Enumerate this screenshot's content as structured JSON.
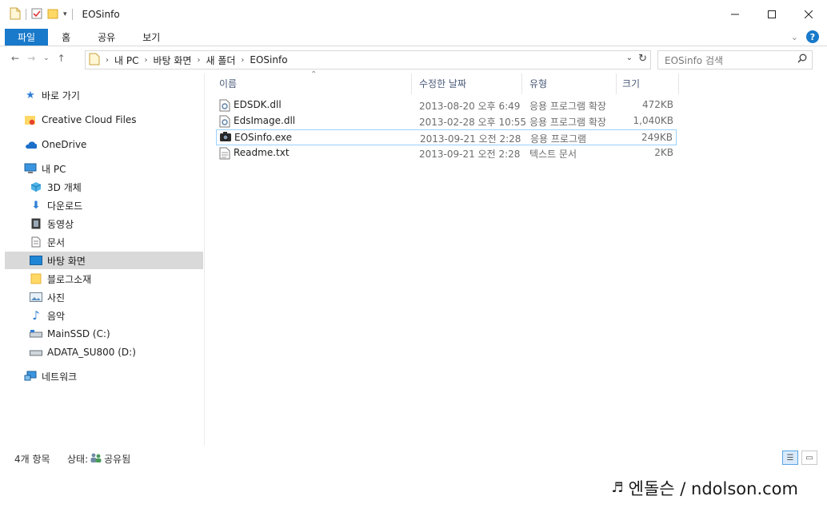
{
  "window": {
    "title": "EOSinfo",
    "controls": [
      "minimize-icon",
      "maximize-icon",
      "close-icon"
    ]
  },
  "ribbon": {
    "tabs": [
      {
        "label": "파일",
        "active": true
      },
      {
        "label": "홈"
      },
      {
        "label": "공유"
      },
      {
        "label": "보기"
      }
    ],
    "help": "?"
  },
  "address": {
    "crumbs": [
      "내 PC",
      "바탕 화면",
      "새 폴더",
      "EOSinfo"
    ],
    "search_placeholder": "EOSinfo 검색"
  },
  "nav": {
    "items": [
      {
        "label": "바로 가기",
        "icon": "star-icon"
      },
      {
        "label": "Creative Cloud Files",
        "icon": "cc-folder-icon"
      },
      {
        "label": "OneDrive",
        "icon": "cloud-icon"
      },
      {
        "label": "내 PC",
        "icon": "pc-icon"
      },
      {
        "label": "3D 개체",
        "icon": "cube-icon"
      },
      {
        "label": "다운로드",
        "icon": "download-icon"
      },
      {
        "label": "동영상",
        "icon": "film-icon"
      },
      {
        "label": "문서",
        "icon": "document-icon"
      },
      {
        "label": "바탕 화면",
        "icon": "desktop-icon",
        "selected": true
      },
      {
        "label": "블로그소재",
        "icon": "folder-icon"
      },
      {
        "label": "사진",
        "icon": "picture-icon"
      },
      {
        "label": "음악",
        "icon": "music-icon"
      },
      {
        "label": "MainSSD (C:)",
        "icon": "drive-icon"
      },
      {
        "label": "ADATA_SU800 (D:)",
        "icon": "drive-icon"
      },
      {
        "label": "네트워크",
        "icon": "network-icon"
      }
    ]
  },
  "columns": {
    "name": "이름",
    "date": "수정한 날짜",
    "type": "유형",
    "size": "크기"
  },
  "files": [
    {
      "name": "EDSDK.dll",
      "date": "2013-08-20 오후 6:49",
      "type": "응용 프로그램 확장",
      "size": "472KB",
      "icon": "dll-icon"
    },
    {
      "name": "EdsImage.dll",
      "date": "2013-02-28 오후 10:55",
      "type": "응용 프로그램 확장",
      "size": "1,040KB",
      "icon": "dll-icon"
    },
    {
      "name": "EOSinfo.exe",
      "date": "2013-09-21 오전 2:28",
      "type": "응용 프로그램",
      "size": "249KB",
      "icon": "camera-icon",
      "selected": true
    },
    {
      "name": "Readme.txt",
      "date": "2013-09-21 오전 2:28",
      "type": "텍스트 문서",
      "size": "2KB",
      "icon": "text-file-icon"
    }
  ],
  "status": {
    "count": "4개 항목",
    "state_label": "상태:",
    "state_value": "공유됨"
  },
  "watermark": {
    "text": "엔돌슨 / ndolson.com"
  }
}
